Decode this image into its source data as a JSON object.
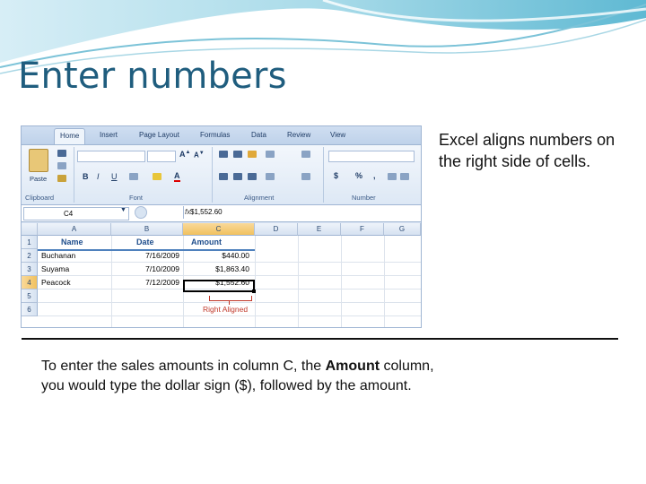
{
  "slide": {
    "title": "Enter numbers",
    "side_text": "Excel aligns numbers on the right side of cells.",
    "caption_pre": "To enter the sales amounts in column C, the ",
    "caption_bold": "Amount",
    "caption_post": " column, you would type the dollar sign ($), followed by the amount."
  },
  "excel": {
    "tabs": [
      "Home",
      "Insert",
      "Page Layout",
      "Formulas",
      "Data",
      "Review",
      "View"
    ],
    "active_tab": "Home",
    "paste_label": "Paste",
    "groups": [
      "Clipboard",
      "Font",
      "Alignment",
      "Number"
    ],
    "number_format_symbols": [
      "$",
      "%",
      ","
    ],
    "font_buttons": [
      "B",
      "I",
      "U"
    ],
    "name_box": "C4",
    "fx_symbol": "fx",
    "formula_value": "$1,552.60",
    "columns": [
      "A",
      "B",
      "C",
      "D",
      "E",
      "F",
      "G"
    ],
    "selected_column": "C",
    "rows": [
      "1",
      "2",
      "3",
      "4",
      "5",
      "6"
    ],
    "selected_row": "4",
    "headers": [
      "Name",
      "Date",
      "Amount"
    ],
    "data": [
      [
        "Buchanan",
        "7/16/2009",
        "$440.00"
      ],
      [
        "Suyama",
        "7/10/2009",
        "$1,863.40"
      ],
      [
        "Peacock",
        "7/12/2009",
        "$1,552.60"
      ]
    ],
    "annotation": "Right Aligned",
    "annotation_color": "#c0392b",
    "accent_color": "#4f81bd"
  }
}
